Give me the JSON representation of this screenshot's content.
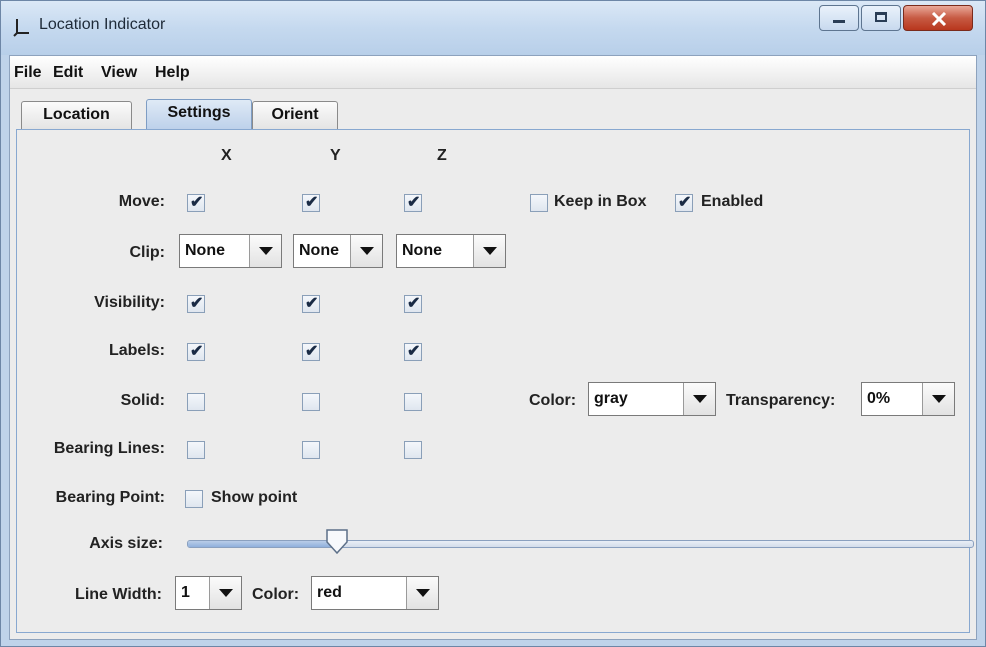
{
  "window": {
    "title": "Location Indicator"
  },
  "menu": [
    "File",
    "Edit",
    "View",
    "Help"
  ],
  "tabs": [
    "Location",
    "Settings",
    "Orient"
  ],
  "active_tab": "Settings",
  "axes": [
    "X",
    "Y",
    "Z"
  ],
  "rows": {
    "move": {
      "label": "Move:",
      "x": true,
      "y": true,
      "z": true
    },
    "visibility": {
      "label": "Visibility:",
      "x": true,
      "y": true,
      "z": true
    },
    "labels": {
      "label": "Labels:",
      "x": true,
      "y": true,
      "z": true
    },
    "solid": {
      "label": "Solid:",
      "x": false,
      "y": false,
      "z": false
    },
    "bearing_lines": {
      "label": "Bearing Lines:",
      "x": false,
      "y": false,
      "z": false
    }
  },
  "keep_in_box": {
    "label": "Keep in Box",
    "checked": false
  },
  "enabled": {
    "label": "Enabled",
    "checked": true
  },
  "clip": {
    "label": "Clip:",
    "x": "None",
    "y": "None",
    "z": "None"
  },
  "solid_color": {
    "label": "Color:",
    "value": "gray"
  },
  "transparency": {
    "label": "Transparency:",
    "value": "0%"
  },
  "bearing_point": {
    "label": "Bearing Point:",
    "show_point_label": "Show point",
    "checked": false
  },
  "axis_size": {
    "label": "Axis size:",
    "level": 0.19
  },
  "line_width": {
    "label": "Line Width:",
    "value": "1"
  },
  "line_color": {
    "label": "Color:",
    "value": "red"
  },
  "colors": {
    "title_bar": "#c5d9ef",
    "close_button": "#c75a43",
    "tab_active": "#bcd0ea",
    "panel_border": "#88a8d0"
  }
}
